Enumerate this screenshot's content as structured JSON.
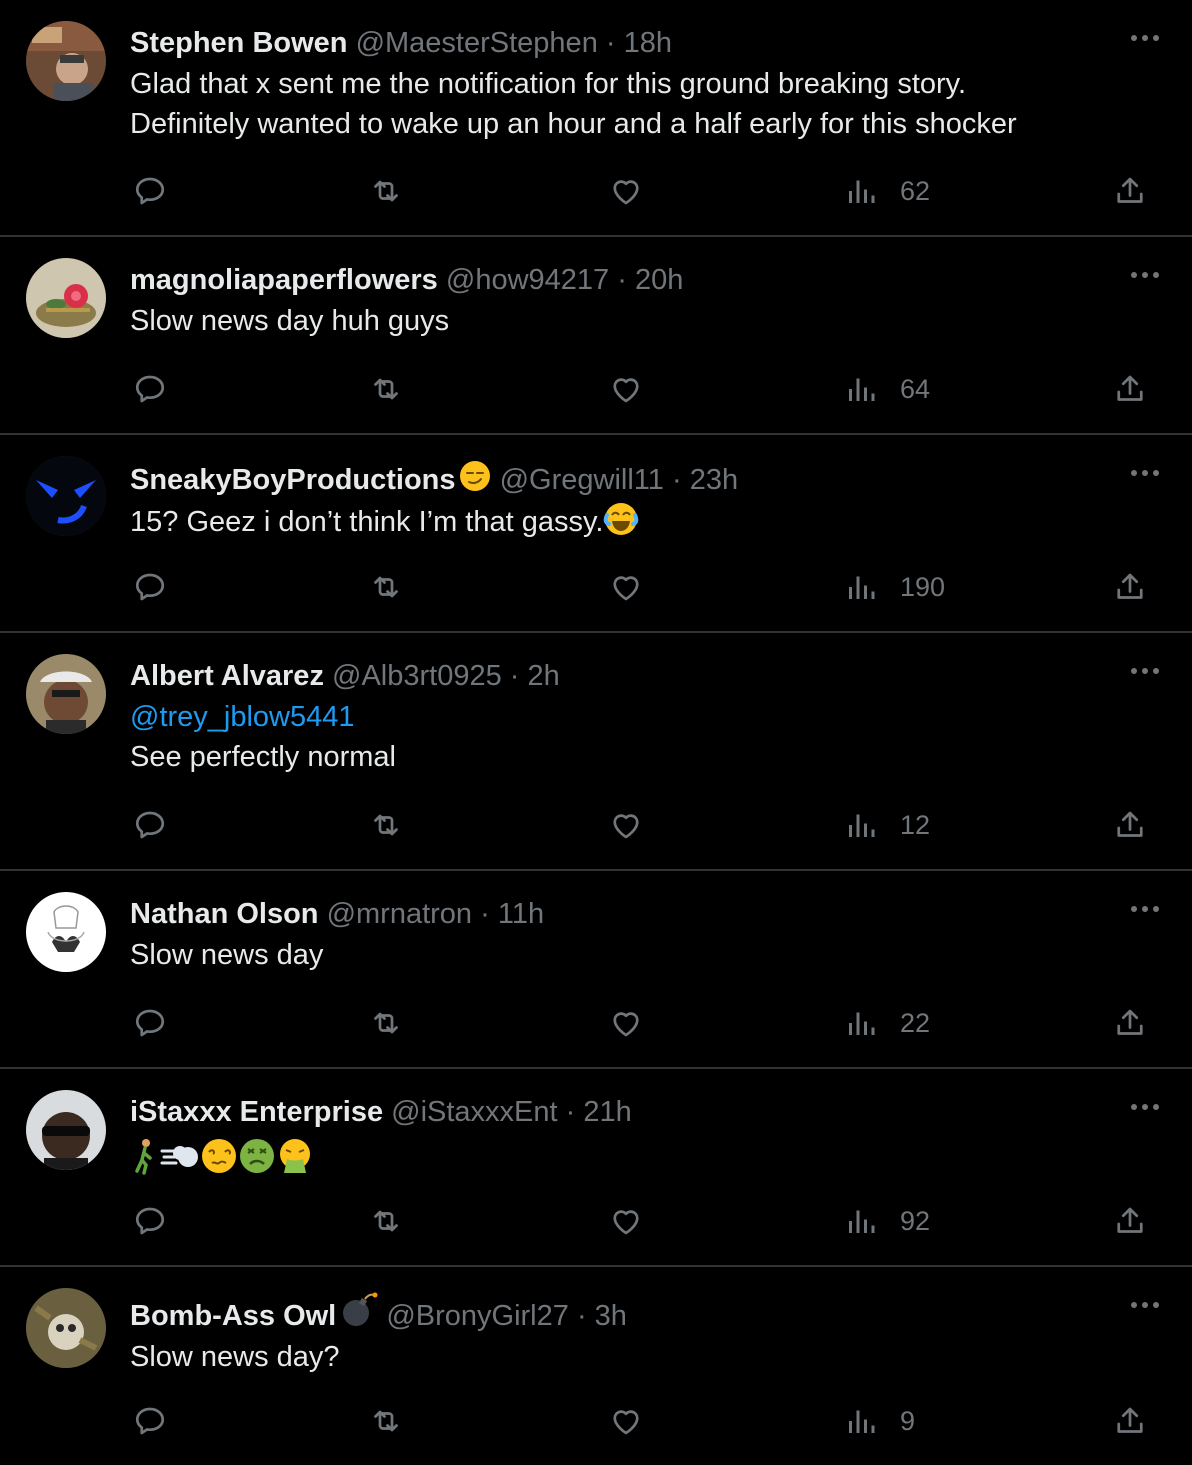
{
  "colors": {
    "background": "#000000",
    "text": "#e7e9ea",
    "muted": "#71767b",
    "link": "#1d9bf0",
    "divider": "#2f3336"
  },
  "tweets": [
    {
      "name": "Stephen Bowen",
      "handle": "@MaesterStephen",
      "dot": "·",
      "time": "18h",
      "lines": [
        "Glad that x sent me the notification for this ground breaking story.",
        "Definitely wanted to wake up an hour and a half early for this shocker"
      ],
      "views": "62"
    },
    {
      "name": "magnoliapaperflowers",
      "handle": "@how94217",
      "dot": "·",
      "time": "20h",
      "lines": [
        "Slow news day huh guys"
      ],
      "views": "64"
    },
    {
      "name": "SneakyBoyProductions",
      "name_emoji": "smirk-emoji",
      "handle": "@Gregwill11",
      "dot": "·",
      "time": "23h",
      "lines": [
        "15? Geez i don’t think I’m that gassy."
      ],
      "text_emoji": "tears-of-joy-emoji",
      "views": "190"
    },
    {
      "name": "Albert Alvarez",
      "handle": "@Alb3rt0925",
      "dot": "·",
      "time": "2h",
      "mention": "@trey_jblow5441",
      "lines": [
        "See perfectly normal"
      ],
      "views": "12"
    },
    {
      "name": "Nathan Olson",
      "handle": "@mrnatron",
      "dot": "·",
      "time": "11h",
      "lines": [
        "Slow news day"
      ],
      "views": "22"
    },
    {
      "name": "iStaxxx Enterprise",
      "handle": "@iStaxxxEnt",
      "dot": "·",
      "time": "21h",
      "emoji_sequence": [
        "person-walking-emoji",
        "dash-emoji",
        "dizzy-face-emoji",
        "nauseated-face-emoji",
        "vomiting-face-emoji"
      ],
      "views": "92"
    },
    {
      "name": "Bomb-Ass Owl",
      "name_emoji": "bomb-emoji",
      "handle": "@BronyGirl27",
      "dot": "·",
      "time": "3h",
      "lines": [
        "Slow news day?"
      ],
      "views": "9"
    }
  ]
}
